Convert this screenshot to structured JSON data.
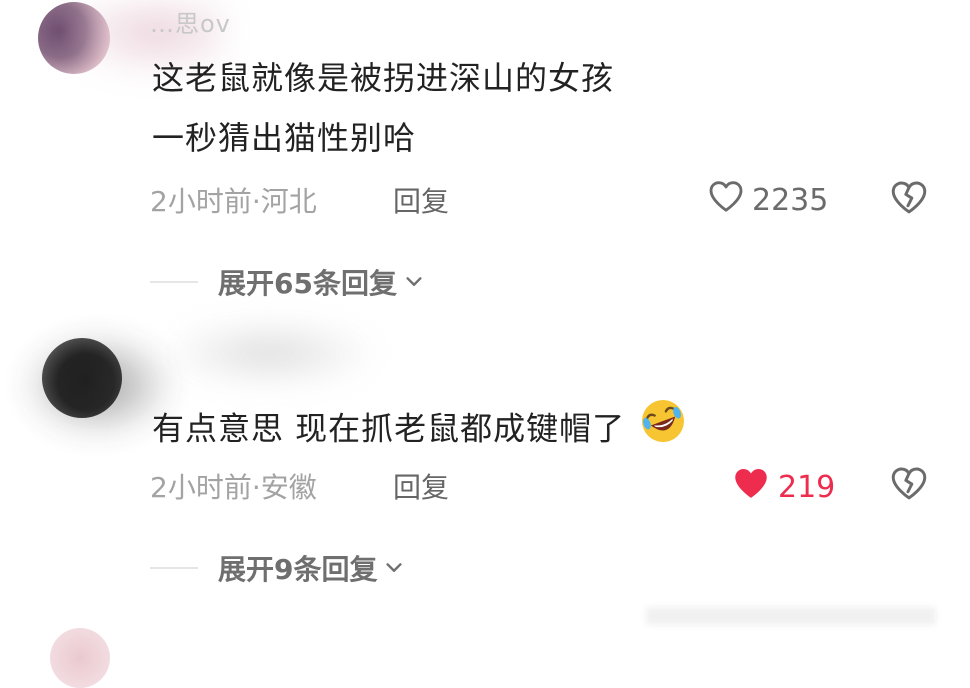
{
  "comments": [
    {
      "username": "…思ov",
      "text_lines": [
        "这老鼠就像是被拐进深山的女孩",
        "一秒猜出猫性别哈"
      ],
      "meta": "2小时前·河北",
      "reply_label": "回复",
      "like_count": "2235",
      "liked": false,
      "expand_label": "展开65条回复"
    },
    {
      "username": "",
      "text_lines": [
        "有点意思 现在抓老鼠都成键帽了"
      ],
      "emoji": "rolling-on-floor-laughing",
      "meta": "2小时前·安徽",
      "reply_label": "回复",
      "like_count": "219",
      "liked": true,
      "expand_label": "展开9条回复"
    }
  ],
  "colors": {
    "liked": "#ee2c4e",
    "muted": "#a3a3a3",
    "text": "#222222"
  },
  "icons": [
    "heart-outline-icon",
    "heart-filled-icon",
    "broken-heart-icon",
    "chevron-down-icon"
  ]
}
